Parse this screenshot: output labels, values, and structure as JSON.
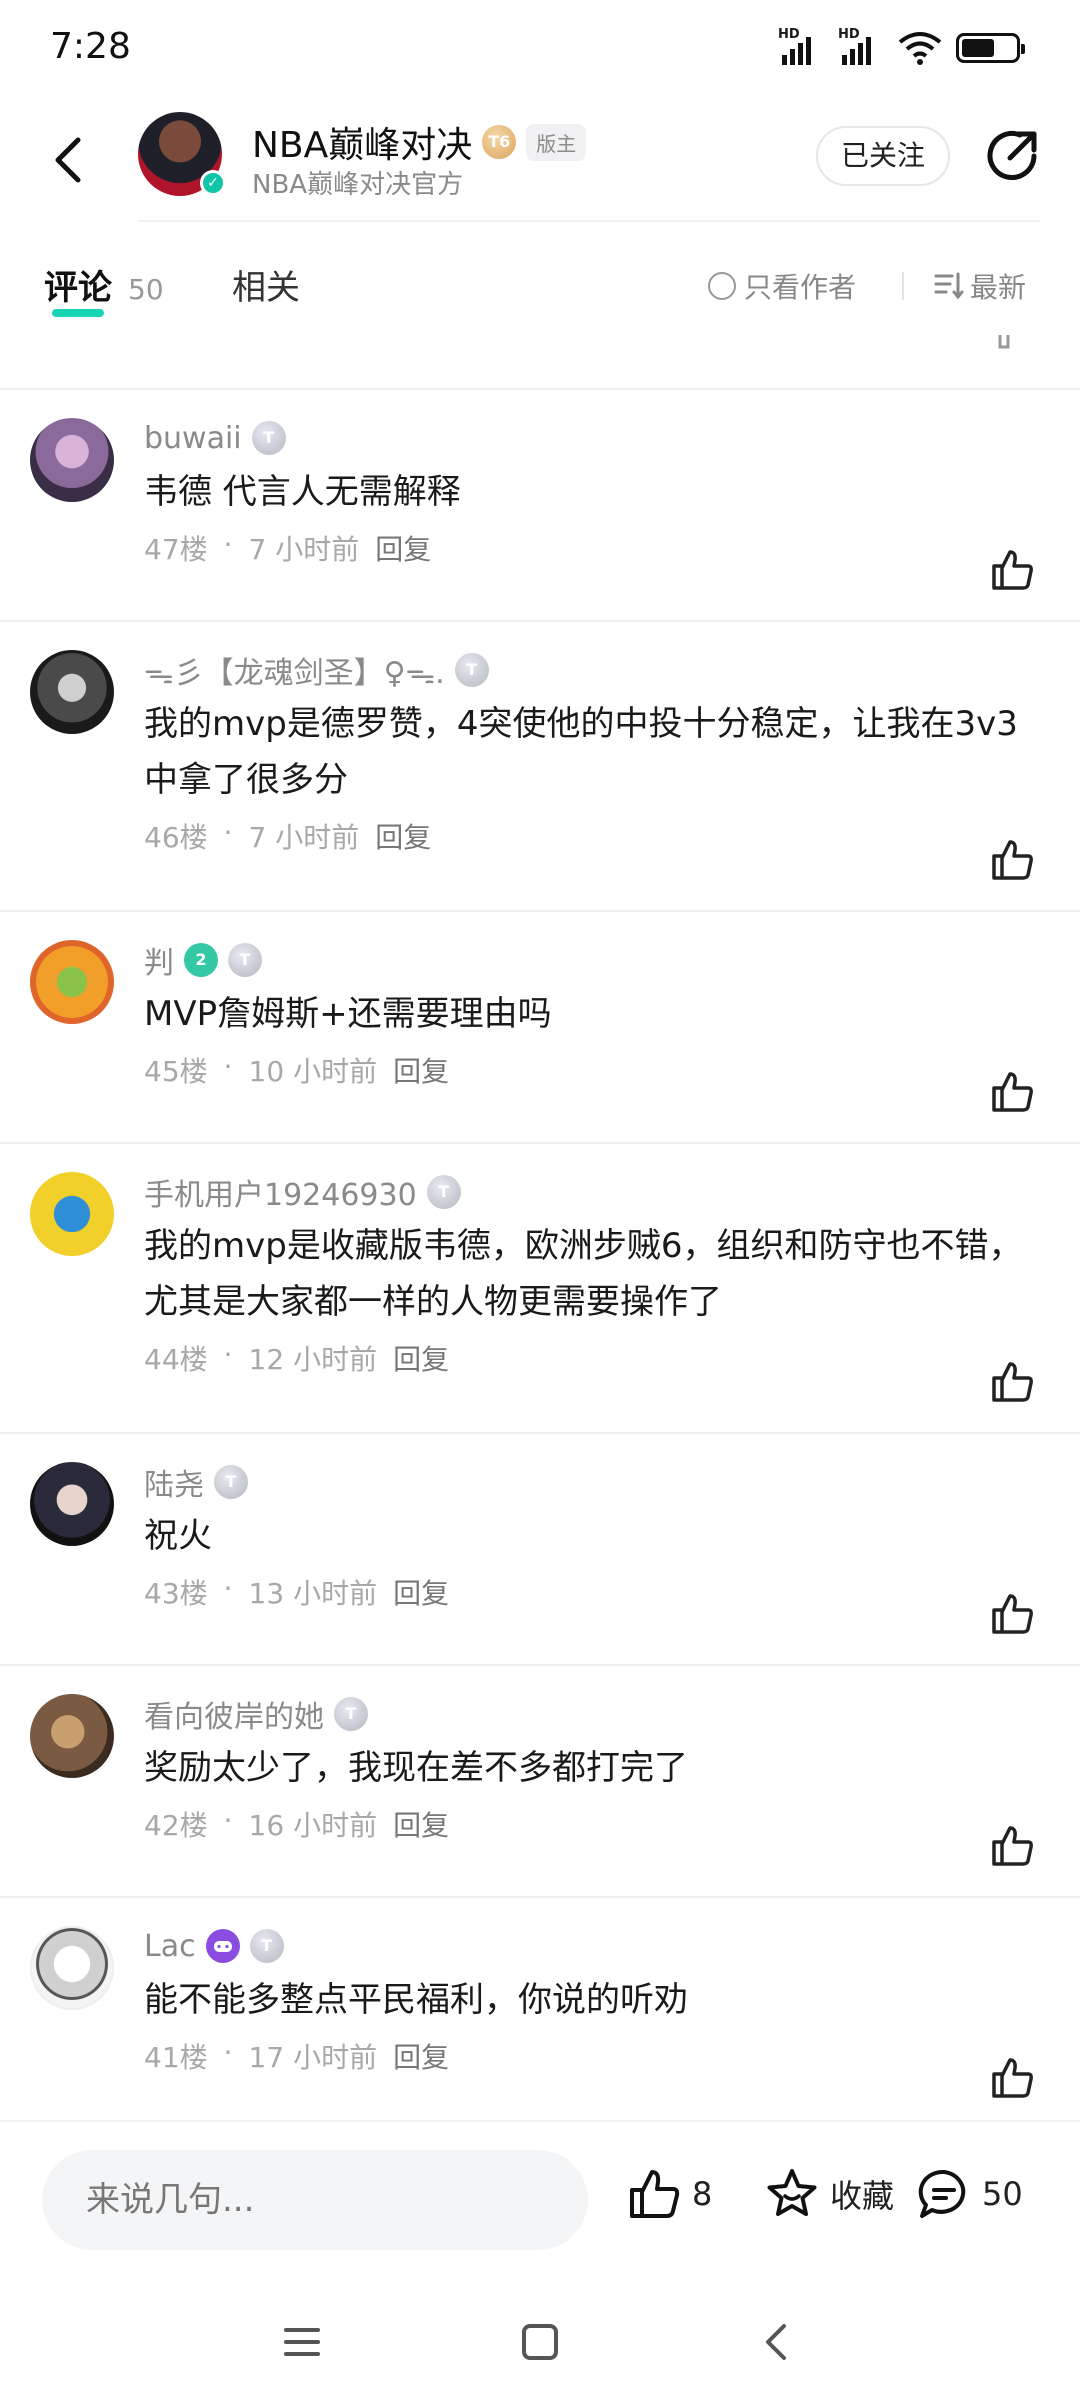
{
  "status": {
    "time": "7:28",
    "hd1": "HD",
    "hd2": "HD"
  },
  "header": {
    "name": "NBA巅峰对决",
    "badge": "T6",
    "role_tag": "版主",
    "subtitle": "NBA巅峰对决官方",
    "follow_label": "已关注"
  },
  "tabs": {
    "comments_label": "评论",
    "comments_count": "50",
    "related_label": "相关",
    "author_only_label": "只看作者",
    "sort_label": "最新"
  },
  "comments": [
    {
      "user": "buwaii",
      "level": "T",
      "text": "韦德  代言人无需解释",
      "floor": "47楼",
      "time": "7 小时前",
      "reply": "回复"
    },
    {
      "user": "ᯓ彡【龙魂剑圣】♀ᯓ.",
      "level": "T",
      "text": "我的mvp是德罗赞，4突使他的中投十分稳定，让我在3v3中拿了很多分",
      "floor": "46楼",
      "time": "7 小时前",
      "reply": "回复"
    },
    {
      "user": "判",
      "level": "T",
      "extra_badge": "2",
      "text": "MVP詹姆斯+还需要理由吗",
      "floor": "45楼",
      "time": "10 小时前",
      "reply": "回复"
    },
    {
      "user": "手机用户19246930",
      "level": "T",
      "text": "我的mvp是收藏版韦德，欧洲步贼6，组织和防守也不错，尤其是大家都一样的人物更需要操作了",
      "floor": "44楼",
      "time": "12 小时前",
      "reply": "回复"
    },
    {
      "user": "陆尧",
      "level": "T",
      "text": "祝火",
      "floor": "43楼",
      "time": "13 小时前",
      "reply": "回复"
    },
    {
      "user": "看向彼岸的她",
      "level": "T",
      "text": "奖励太少了，我现在差不多都打完了",
      "floor": "42楼",
      "time": "16 小时前",
      "reply": "回复"
    },
    {
      "user": "Lac",
      "level": "T",
      "extra_badge": "game",
      "text": "能不能多整点平民福利，你说的听劝",
      "floor": "41楼",
      "time": "17 小时前",
      "reply": "回复"
    }
  ],
  "bottom": {
    "input_placeholder": "来说几句...",
    "like_count": "8",
    "favorite_label": "收藏",
    "comment_count": "50"
  },
  "colors": {
    "accent": "#19d3b5",
    "muted": "#8a8a8a",
    "text": "#1a1a1a"
  }
}
